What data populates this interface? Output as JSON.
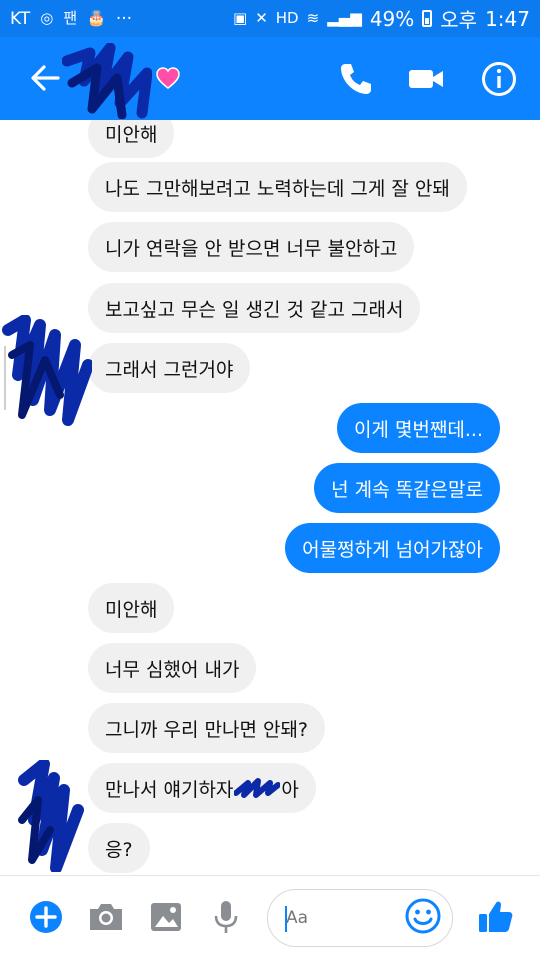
{
  "status_bar": {
    "carrier": "KT",
    "battery": "49%",
    "ampm": "오후",
    "time": "1:47",
    "more": "···",
    "hd_label": "HD"
  },
  "header": {
    "back_icon": "arrow-left-icon",
    "status_emoji": "heart-icon",
    "call_icon": "phone-icon",
    "video_icon": "video-camera-icon",
    "info_icon": "info-icon",
    "accent_color": "#0d83ff"
  },
  "messages": [
    {
      "side": "in",
      "text": "미안해"
    },
    {
      "side": "in",
      "text": "나도 그만해보려고 노력하는데 그게 잘 안돼"
    },
    {
      "side": "in",
      "text": "니가 연락을 안 받으면 너무 불안하고"
    },
    {
      "side": "in",
      "text": "보고싶고 무슨 일 생긴 것 같고 그래서"
    },
    {
      "side": "in",
      "text": "그래서 그런거야"
    },
    {
      "side": "out",
      "text": "이게 몇번짼데..."
    },
    {
      "side": "out",
      "text": "넌 계속 똑같은말로"
    },
    {
      "side": "out",
      "text": "어물쩡하게 넘어가잖아"
    },
    {
      "side": "in",
      "text": "미안해"
    },
    {
      "side": "in",
      "text": "너무 심했어 내가"
    },
    {
      "side": "in",
      "text": "그니까 우리 만나면 안돼?"
    },
    {
      "side": "in",
      "text": "만나서 얘기하자",
      "suffix": "아"
    },
    {
      "side": "in",
      "text": "응?"
    }
  ],
  "composer": {
    "placeholder": "Aa",
    "plus_icon": "plus-icon",
    "camera_icon": "camera-icon",
    "gallery_icon": "image-icon",
    "mic_icon": "microphone-icon",
    "emoji_icon": "smiley-icon",
    "like_icon": "thumbs-up-icon"
  }
}
